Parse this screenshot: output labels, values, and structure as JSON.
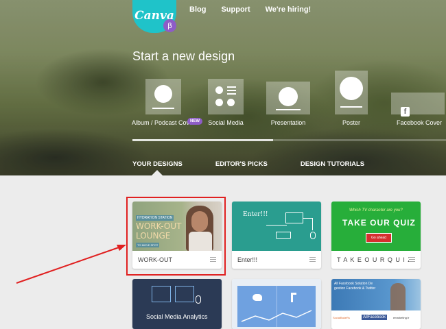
{
  "brand": {
    "logo_text": "Canva",
    "beta": "β",
    "teal": "#1fc3c9",
    "purple": "#8e5cc7"
  },
  "topnav": {
    "blog": "Blog",
    "support": "Support",
    "hiring": "We're hiring!"
  },
  "hero": {
    "title": "Start a new design"
  },
  "design_types": [
    {
      "label": "Album / Podcast Cover",
      "icon": "album-cover-icon",
      "badge": "NEW"
    },
    {
      "label": "Social Media",
      "icon": "social-media-icon"
    },
    {
      "label": "Presentation",
      "icon": "presentation-icon"
    },
    {
      "label": "Poster",
      "icon": "poster-icon"
    },
    {
      "label": "Facebook Cover",
      "icon": "facebook-cover-icon",
      "glyph": "f"
    }
  ],
  "tabs": [
    "YOUR DESIGNS",
    "EDITOR'S PICKS",
    "DESIGN TUTORIALS"
  ],
  "designs": [
    {
      "title": "WORK-OUT",
      "thumb": {
        "line1": "HYDRATION STATION",
        "line2": "WORK-OUT",
        "line3": "LOUNGE",
        "tag": "TO MOVE SPOT"
      }
    },
    {
      "title": "Enter!!!",
      "thumb": {
        "heading": "Enter!!!"
      }
    },
    {
      "title": "T A K E  O U R  Q U I Z",
      "thumb": {
        "question": "Which TV character are you?",
        "heading": "TAKE OUR QUIZ",
        "button": "Go ahead"
      }
    },
    {
      "title": "",
      "thumb": {
        "caption": "Social Media Analytics"
      }
    },
    {
      "title": "",
      "thumb": {}
    },
    {
      "title": "",
      "thumb": {
        "line1": "All Facebook Solution De",
        "line2": "gestion Facebook & Twitter",
        "logo1": "SocialBakeRs",
        "logo2": "AllFacebook",
        "logo3": "emarketing.fr"
      }
    }
  ]
}
